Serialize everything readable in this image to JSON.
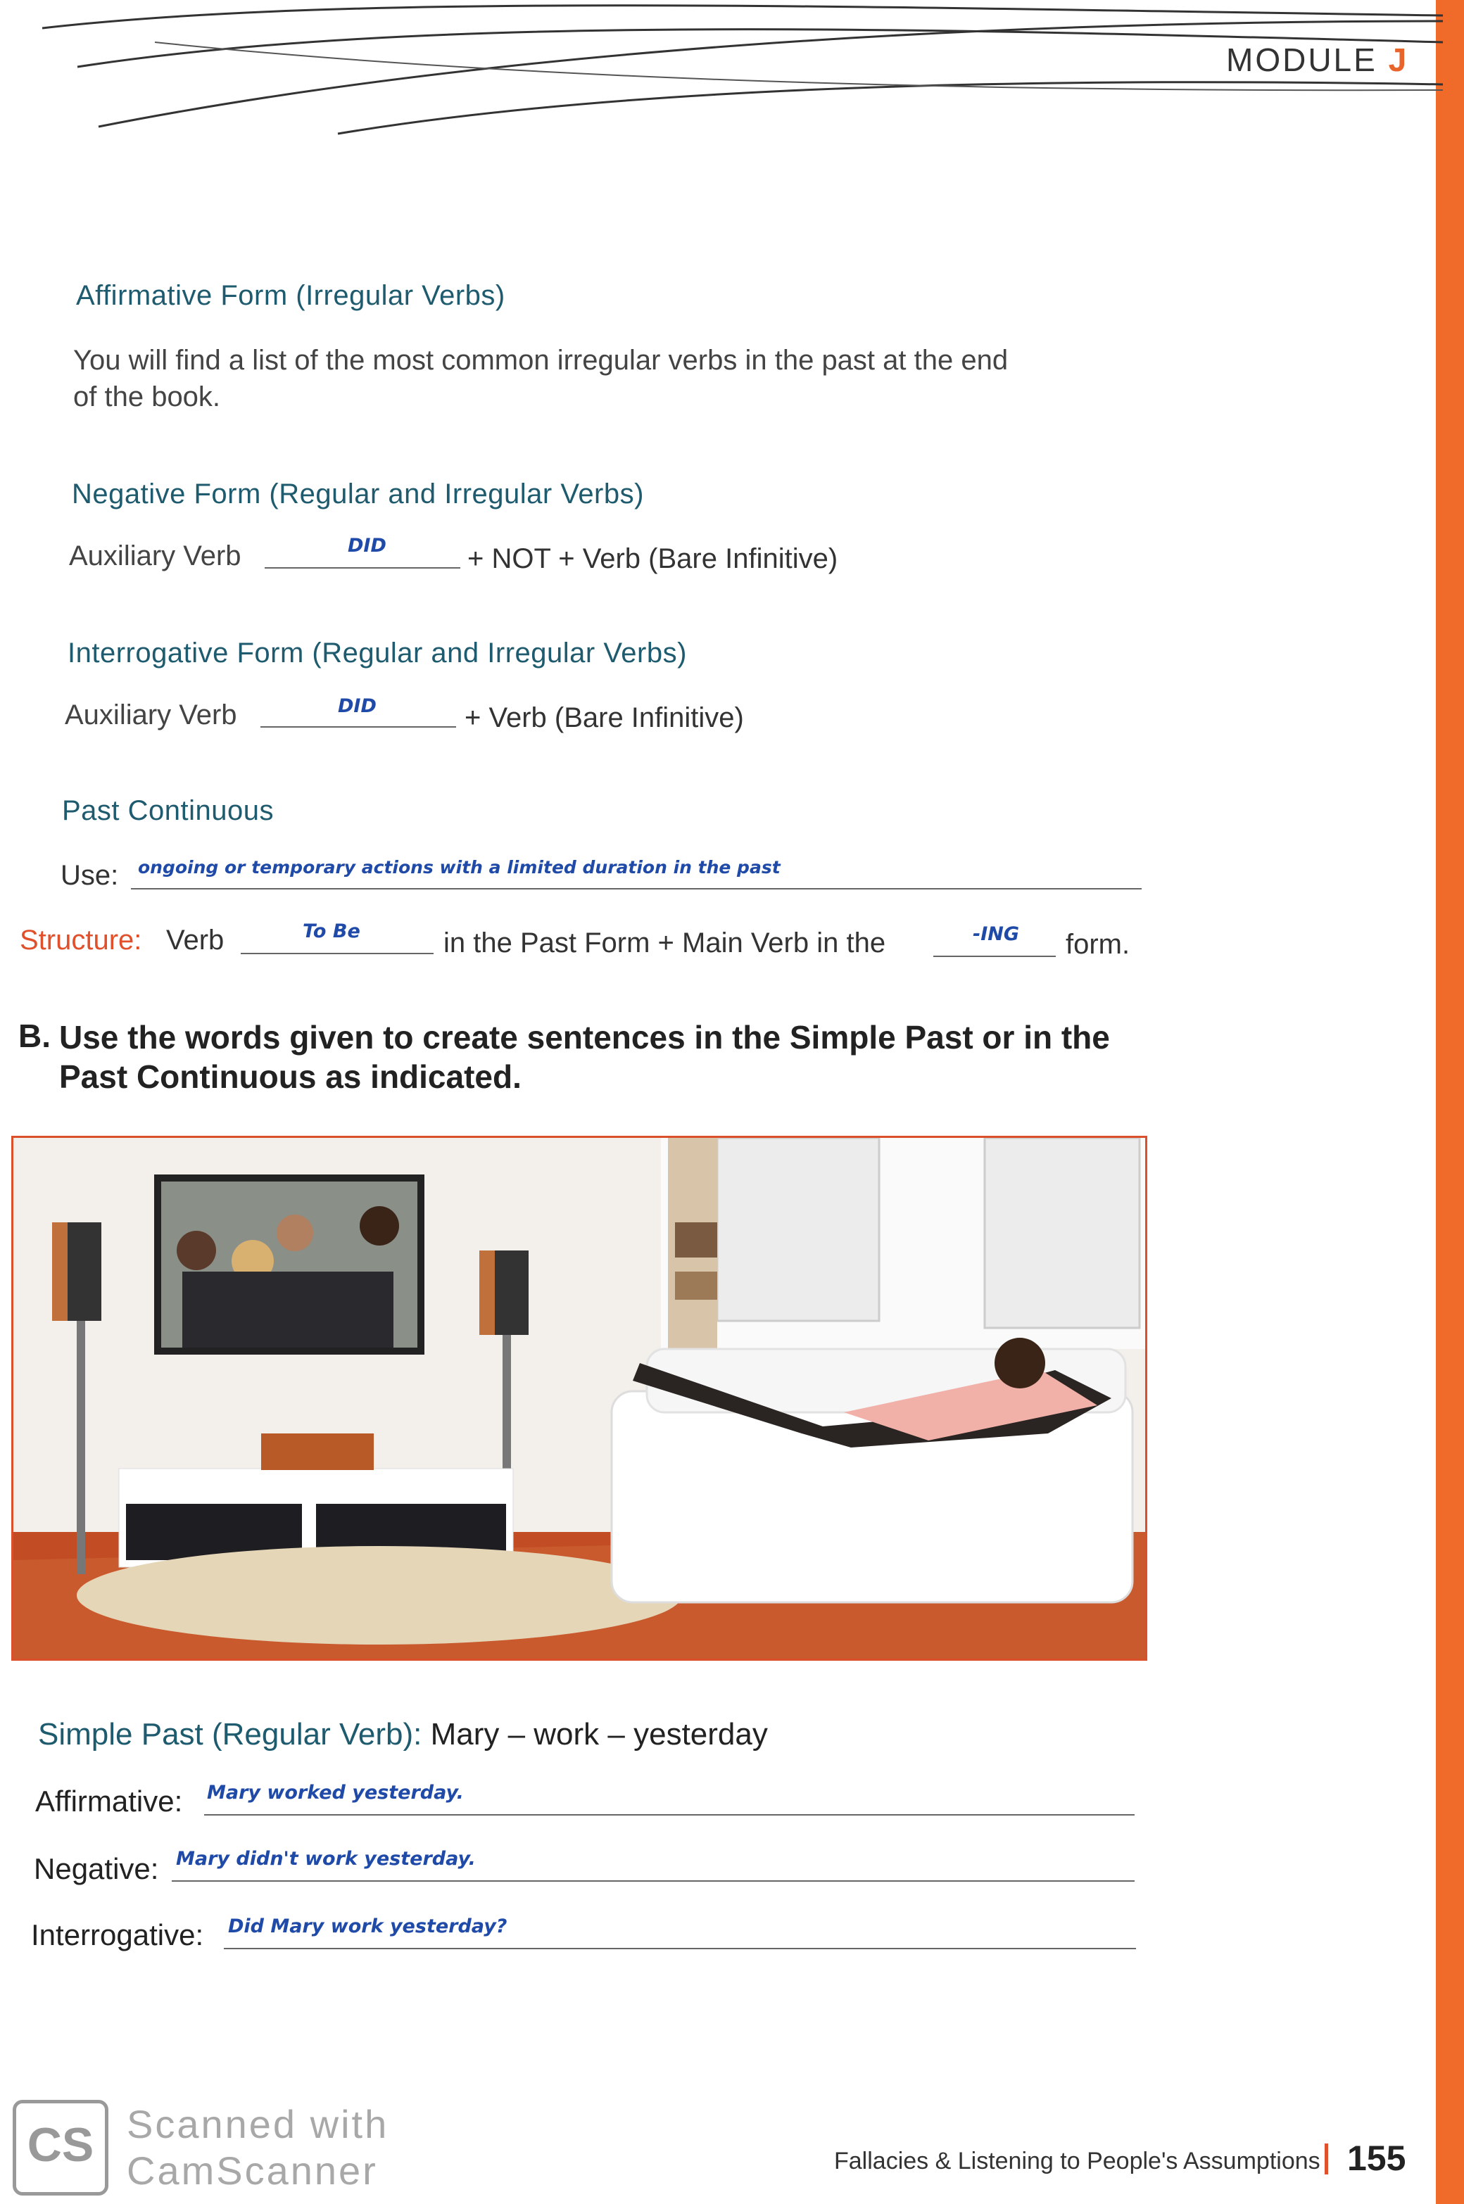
{
  "header": {
    "module_label": "MODULE",
    "module_letter": "J"
  },
  "affirmative_irregular": {
    "heading": "Affirmative Form (Irregular Verbs)",
    "text_line1": "You will find a list of the most common irregular verbs in the past at the end",
    "text_line2": "of the book."
  },
  "negative": {
    "heading": "Negative Form (Regular and Irregular Verbs)",
    "prefix": "Auxiliary Verb",
    "answer": "DID",
    "suffix": "+ NOT + Verb (Bare Infinitive)"
  },
  "interrogative": {
    "heading": "Interrogative Form (Regular and Irregular Verbs)",
    "prefix": "Auxiliary Verb",
    "answer": "DID",
    "suffix": "+ Verb (Bare Infinitive)"
  },
  "past_continuous": {
    "heading": "Past Continuous",
    "use_label": "Use:",
    "use_answer": "ongoing or temporary actions with a limited duration in the past",
    "structure_label": "Structure:",
    "structure_text1": "Verb",
    "structure_answer1": "To Be",
    "structure_text2": "in the Past Form + Main Verb in the",
    "structure_answer2": "-ING",
    "structure_text3": "form."
  },
  "exercise_b": {
    "letter": "B.",
    "instruction_line1": "Use the words given to create sentences in the Simple Past or in the",
    "instruction_line2": "Past Continuous as indicated."
  },
  "simple_past_item": {
    "prompt_label": "Simple Past (Regular Verb):",
    "prompt_words": "Mary – work – yesterday",
    "affirmative_label": "Affirmative:",
    "affirmative_answer": "Mary worked yesterday.",
    "negative_label": "Negative:",
    "negative_answer": "Mary didn't work yesterday.",
    "interrogative_label": "Interrogative:",
    "interrogative_answer": "Did Mary work yesterday?"
  },
  "footer": {
    "chapter_title": "Fallacies & Listening to People's Assumptions",
    "page_number": "155",
    "scanner_line1": "Scanned with",
    "scanner_line2": "CamScanner",
    "scanner_logo": "CS"
  },
  "colors": {
    "accent_orange": "#f06a2a",
    "heading_teal": "#1f5b6e",
    "handwriting_blue": "#1f4aa8"
  }
}
